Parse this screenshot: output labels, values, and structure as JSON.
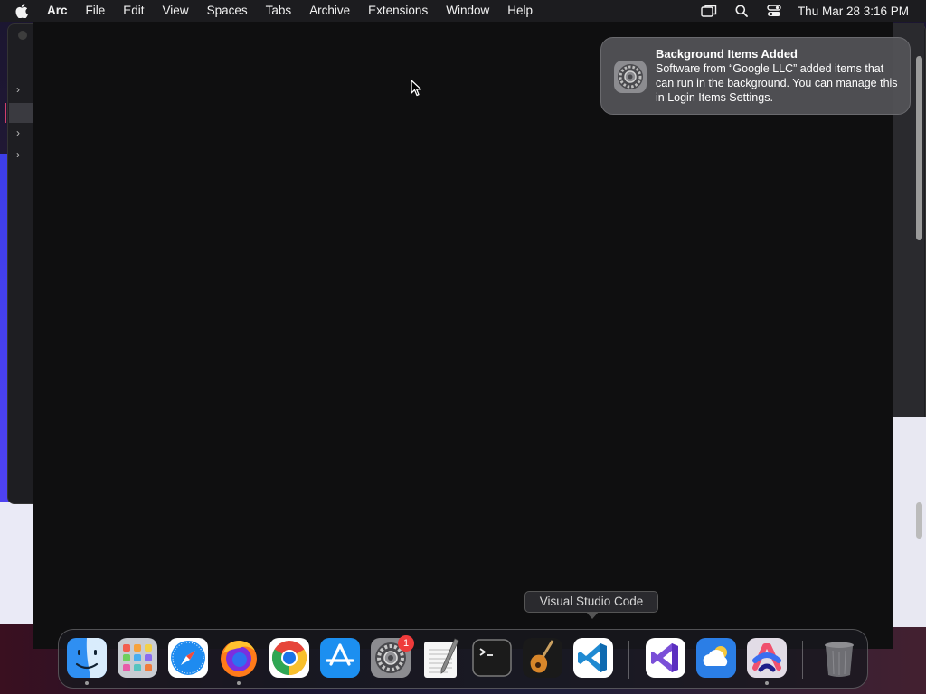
{
  "menubar": {
    "app_name": "Arc",
    "items": [
      "File",
      "Edit",
      "View",
      "Spaces",
      "Tabs",
      "Archive",
      "Extensions",
      "Window",
      "Help"
    ],
    "clock": "Thu Mar 28  3:16 PM",
    "status_icons": [
      "screen-mirroring-icon",
      "search-icon",
      "control-center-icon"
    ]
  },
  "notification": {
    "title": "Background Items Added",
    "body": "Software from “Google LLC” added items that can run in the background. You can manage this in Login Items Settings.",
    "icon": "system-settings-gear-icon"
  },
  "tooltip": {
    "label": "Visual Studio Code"
  },
  "dock": {
    "items": [
      {
        "name": "Finder",
        "icon": "finder-icon",
        "running": true
      },
      {
        "name": "Launchpad",
        "icon": "launchpad-icon",
        "running": false
      },
      {
        "name": "Safari",
        "icon": "safari-icon",
        "running": false
      },
      {
        "name": "Firefox",
        "icon": "firefox-icon",
        "running": true
      },
      {
        "name": "Google Chrome",
        "icon": "chrome-icon",
        "running": false
      },
      {
        "name": "App Store",
        "icon": "app-store-icon",
        "running": false
      },
      {
        "name": "System Settings",
        "icon": "system-settings-icon",
        "running": false,
        "badge": "1"
      },
      {
        "name": "TextEdit",
        "icon": "textedit-icon",
        "running": false
      },
      {
        "name": "Terminal",
        "icon": "terminal-icon",
        "running": false
      },
      {
        "name": "GarageBand",
        "icon": "garageband-icon",
        "running": false
      },
      {
        "name": "Visual Studio Code",
        "icon": "vscode-icon",
        "running": false
      },
      {
        "name": "Visual Studio",
        "icon": "visual-studio-icon",
        "running": false
      },
      {
        "name": "Weather",
        "icon": "weather-icon",
        "running": false
      },
      {
        "name": "Arc",
        "icon": "arc-icon",
        "running": true
      },
      {
        "name": "Trash",
        "icon": "trash-icon",
        "running": false
      }
    ]
  },
  "colors": {
    "menubar_bg": "#1c1c1f",
    "window_bg": "#0f0f10",
    "badge_red": "#ef3b3b",
    "notification_bg": "#545458"
  }
}
